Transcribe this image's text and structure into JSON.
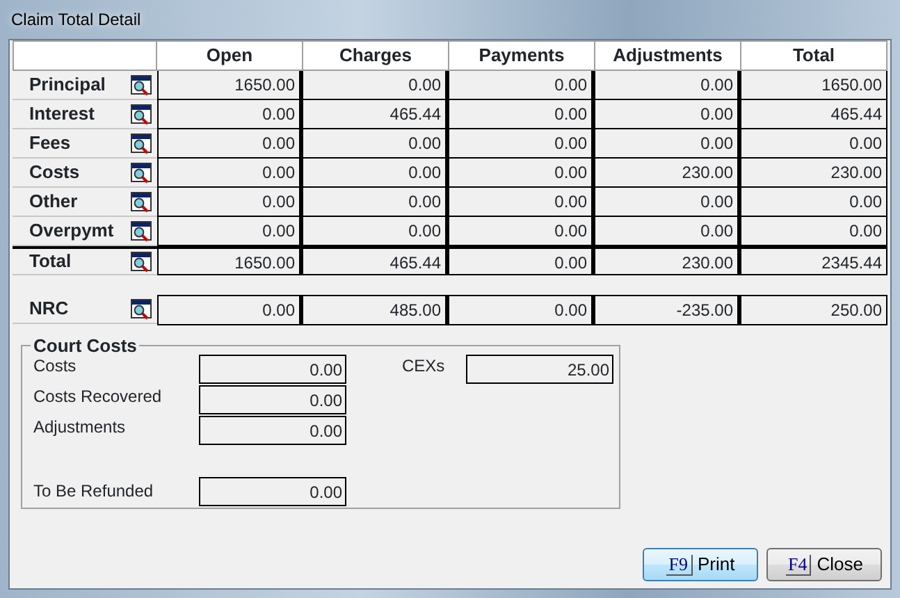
{
  "window": {
    "title": "Claim Total Detail"
  },
  "table": {
    "columns": [
      "Open",
      "Charges",
      "Payments",
      "Adjustments",
      "Total"
    ],
    "rows": [
      {
        "label": "Principal",
        "kind": "item",
        "values": [
          "1650.00",
          "0.00",
          "0.00",
          "0.00",
          "1650.00"
        ]
      },
      {
        "label": "Interest",
        "kind": "item",
        "values": [
          "0.00",
          "465.44",
          "0.00",
          "0.00",
          "465.44"
        ]
      },
      {
        "label": "Fees",
        "kind": "item",
        "values": [
          "0.00",
          "0.00",
          "0.00",
          "0.00",
          "0.00"
        ]
      },
      {
        "label": "Costs",
        "kind": "item",
        "values": [
          "0.00",
          "0.00",
          "0.00",
          "230.00",
          "230.00"
        ]
      },
      {
        "label": "Other",
        "kind": "item",
        "values": [
          "0.00",
          "0.00",
          "0.00",
          "0.00",
          "0.00"
        ]
      },
      {
        "label": "Overpymt",
        "kind": "item",
        "values": [
          "0.00",
          "0.00",
          "0.00",
          "0.00",
          "0.00"
        ]
      },
      {
        "label": "Total",
        "kind": "total",
        "values": [
          "1650.00",
          "465.44",
          "0.00",
          "230.00",
          "2345.44"
        ]
      }
    ]
  },
  "nrc": {
    "label": "NRC",
    "values": [
      "0.00",
      "485.00",
      "0.00",
      "-235.00",
      "250.00"
    ]
  },
  "court_costs": {
    "title": "Court Costs",
    "fields": [
      {
        "label": "Costs",
        "value": "0.00"
      },
      {
        "label": "Costs Recovered",
        "value": "0.00"
      },
      {
        "label": "Adjustments",
        "value": "0.00"
      },
      {
        "label": "To Be Refunded",
        "value": "0.00"
      }
    ],
    "cex": {
      "label": "CEXs",
      "value": "25.00"
    }
  },
  "buttons": [
    {
      "key": "F9",
      "label": "Print",
      "default": true
    },
    {
      "key": "F4",
      "label": "Close",
      "default": false
    }
  ]
}
